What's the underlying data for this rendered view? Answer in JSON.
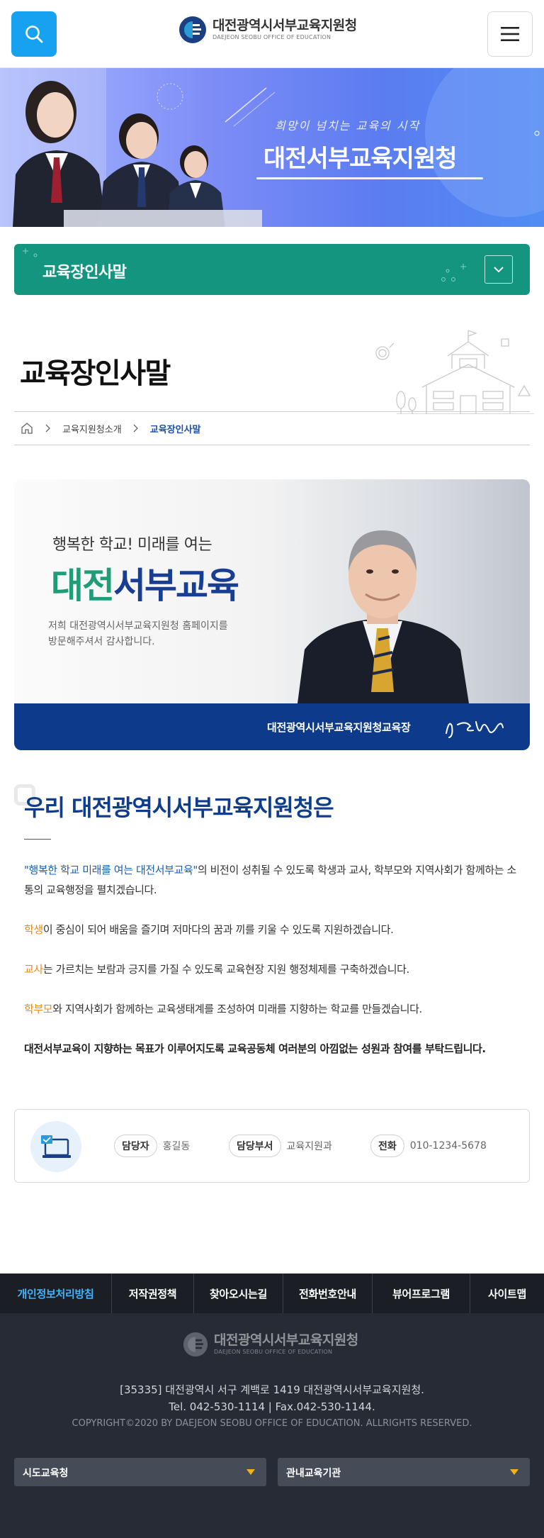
{
  "header": {
    "org_name_ko": "대전광역시서부교육지원청",
    "org_name_en": "DAEJEON SEOBU OFFICE OF EDUCATION",
    "search_icon": "search-icon",
    "menu_icon": "hamburger-menu-icon"
  },
  "hero": {
    "slogan": "희망이 넘치는 교육의 시작",
    "title": "대전서부교육지원청"
  },
  "category_bar": {
    "label": "교육장인사말",
    "toggle_icon": "chevron-down-icon"
  },
  "page": {
    "title": "교육장인사말"
  },
  "breadcrumb": {
    "items": [
      "교육지원청소개",
      "교육장인사말"
    ]
  },
  "greeting": {
    "subtitle": "행복한 학교! 미래를 여는",
    "brand_part1": "대전",
    "brand_part2": "서부교육",
    "desc_line1": "저희 대전광역시서부교육지원청 홈페이지를",
    "desc_line2": "방문해주셔서 감사합니다.",
    "signer_title": "대전광역시서부교육지원청교육장"
  },
  "vision": {
    "heading": "우리 대전광역시서부교육지원청은",
    "p1_quote": "\"행복한 학교 미래를 여는 대전서부교육\"",
    "p1_rest": "의 비전이 성취될 수 있도록 학생과 교사, 학부모와 지역사회가 함께하는 소통의 교육행정을 펼치겠습니다.",
    "p2_key": "학생",
    "p2_rest": "이 중심이 되어 배움을 즐기며 저마다의 꿈과 끼를 키울 수 있도록 지원하겠습니다.",
    "p3_key": "교사",
    "p3_rest": "는 가르치는 보람과 긍지를 가질 수 있도록 교육현장 지원 행정체제를 구축하겠습니다.",
    "p4_key": "학부모",
    "p4_rest": "와 지역사회가 함께하는 교육생태계를 조성하여 미래를 지향하는 학교를 만들겠습니다.",
    "p5": "대전서부교육이 지향하는 목표가 이루어지도록 교육공동체 여러분의 아낌없는 성원과 참여를 부탁드립니다."
  },
  "contact": {
    "manager_label": "담당자",
    "manager_value": "홍길동",
    "dept_label": "담당부서",
    "dept_value": "교육지원과",
    "phone_label": "전화",
    "phone_value": "010-1234-5678"
  },
  "footer": {
    "nav": [
      {
        "label": "개인정보처리방침",
        "active": true
      },
      {
        "label": "저작권정책"
      },
      {
        "label": "찾아오시는길"
      },
      {
        "label": "전화번호안내"
      },
      {
        "label": "뷰어프로그램"
      },
      {
        "label": "사이트맵"
      }
    ],
    "org_name_ko": "대전광역시서부교육지원청",
    "org_name_en": "DAEJEON SEOBU OFFICE OF EDUCATION",
    "address": "[35335] 대전광역시 서구 계백로 1419 대전광역시서부교육지원청.",
    "tel": "Tel. 042-530-1114 | Fax.042-530-1144.",
    "copyright": "COPYRIGHT©2020 BY DAEJEON SEOBU OFFICE OF EDUCATION. ALLRIGHTS RESERVED.",
    "select1": "시도교육청",
    "select2": "관내교육기관"
  },
  "colors": {
    "accent_blue": "#16a2f0",
    "category_green": "#14957f",
    "navy": "#0d3a8a",
    "footer_bg": "#272b35",
    "highlight_orange": "#f08a16"
  }
}
